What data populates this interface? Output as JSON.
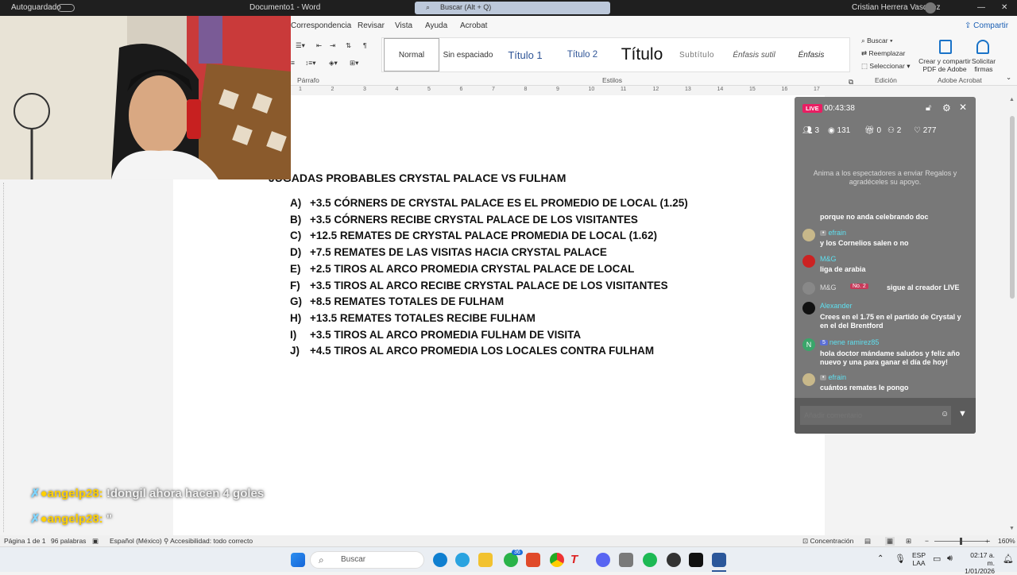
{
  "titlebar": {
    "autosave": "Autoguardado",
    "doc_title": "Documento1 - Word",
    "search_placeholder": "Buscar (Alt + Q)",
    "user": "Cristian Herrera Vasquez"
  },
  "ribbon": {
    "tabs": [
      "Correspondencia",
      "Revisar",
      "Vista",
      "Ayuda",
      "Acrobat"
    ],
    "share": "Compartir",
    "styles": [
      "Normal",
      "Sin espaciado",
      "Título 1",
      "Título 2",
      "Título",
      "Subtítulo",
      "Énfasis sutil",
      "Énfasis"
    ],
    "groups": {
      "parrafo": "Párrafo",
      "estilos": "Estilos",
      "edicion": "Edición",
      "adobe": "Adobe Acrobat"
    },
    "edit_buttons": [
      "Buscar",
      "Reemplazar",
      "Seleccionar"
    ],
    "adobe_create": "Crear y compartir PDF de Adobe",
    "adobe_sign": "Solicitar firmas"
  },
  "ruler_ticks": [
    "1",
    "2",
    "3",
    "4",
    "5",
    "6",
    "7",
    "8",
    "9",
    "10",
    "11",
    "12",
    "13",
    "14",
    "15",
    "16",
    "17"
  ],
  "document": {
    "title": "JUGADAS PROBABLES CRYSTAL PALACE VS FULHAM",
    "items": [
      {
        "label": "A)",
        "text": "+3.5 CÓRNERS DE CRYSTAL PALACE ES EL PROMEDIO DE LOCAL (1.25)"
      },
      {
        "label": "B)",
        "text": "+3.5 CÓRNERS RECIBE CRYSTAL PALACE DE LOS VISITANTES"
      },
      {
        "label": "C)",
        "text": "+12.5 REMATES DE CRYSTAL PALACE PROMEDIA DE LOCAL (1.62)"
      },
      {
        "label": "D)",
        "text": "+7.5 REMATES DE LAS VISITAS HACIA CRYSTAL PALACE"
      },
      {
        "label": "E)",
        "text": "+2.5 TIROS AL ARCO PROMEDIA CRYSTAL PALACE DE LOCAL"
      },
      {
        "label": "F)",
        "text": "+3.5 TIROS AL ARCO RECIBE CRYSTAL PALACE DE LOS VISITANTES"
      },
      {
        "label": "G)",
        "text": "+8.5 REMATES TOTALES DE FULHAM"
      },
      {
        "label": "H)",
        "text": "+13.5 REMATES TOTALES RECIBE FULHAM"
      },
      {
        "label": "I)",
        "text": "+3.5 TIROS AL ARCO PROMEDIA FULHAM DE VISITA"
      },
      {
        "label": "J)",
        "text": "+4.5 TIROS AL ARCO PROMEDIA LOS LOCALES CONTRA FULHAM"
      }
    ]
  },
  "overlay": [
    {
      "user": "angelp28:",
      "msg": "!dongil ahora hacen 4 goles"
    },
    {
      "user": "angelp28:",
      "msg": "\""
    }
  ],
  "live": {
    "badge": "LIVE",
    "timer": "00:43:38",
    "stats": {
      "viewers_now": "3",
      "views": "131",
      "gifts": "0",
      "followers": "2",
      "likes": "277"
    },
    "prompt": "Anima a los espectadores a enviar Regalos y agradéceles su apoyo.",
    "messages": [
      {
        "name": "",
        "text": "porque no anda celebrando doc"
      },
      {
        "name": "efrain",
        "text": "y los Cornelios salen o no"
      },
      {
        "name": "M&G",
        "text": "liga de arabia"
      },
      {
        "name": "M&G",
        "badge": "No. 2",
        "text": "sigue al creador LIVE"
      },
      {
        "name": "Alexander",
        "text": "Crees en el 1.75 en el partido de Crystal y en el del Brentford"
      },
      {
        "name": "nene ramirez85",
        "level": "5",
        "text": "hola doctor mándame saludos y feliz año nuevo y una para ganar el día de hoy!"
      },
      {
        "name": "efrain",
        "text": "cuántos remates le pongo"
      }
    ],
    "comment_placeholder": "Añadir comentario"
  },
  "statusbar": {
    "page": "Página 1 de 1",
    "words": "96 palabras",
    "language": "Español (México)",
    "accessibility": "Accesibilidad: todo correcto",
    "focus": "Concentración",
    "zoom": "160%"
  },
  "taskbar": {
    "search": "Buscar",
    "lang": "ESP",
    "lang2": "LAA",
    "time": "02:17 a. m.",
    "date": "1/01/2026",
    "whatsapp_badge": "36"
  },
  "colors": {
    "live": "#e91e63",
    "name_cyan": "#5ee0f0",
    "overlay_yellow": "#ffd000"
  }
}
